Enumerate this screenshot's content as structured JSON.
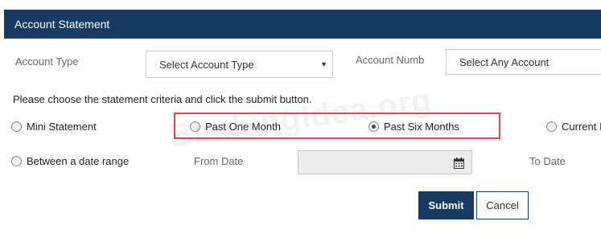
{
  "header": {
    "title": "Account Statement"
  },
  "account_type": {
    "label": "Account Type",
    "selected": "Select Account Type"
  },
  "account_number": {
    "label": "Account Numb",
    "selected": "Select Any Account"
  },
  "instructions": "Please choose the statement criteria and click the submit button.",
  "options": {
    "mini_statement": "Mini Statement",
    "past_one_month": "Past One Month",
    "past_six_months": "Past Six Months",
    "current": "Current I",
    "date_range": "Between a date range"
  },
  "selected_option": "past_six_months",
  "date_range": {
    "from_label": "From Date",
    "to_label": "To Date"
  },
  "buttons": {
    "submit": "Submit",
    "cancel": "Cancel"
  },
  "watermark": "BankingIdea.org",
  "colors": {
    "header_bg": "#173a63",
    "highlight": "#e0474c"
  },
  "icons": {
    "calendar": "calendar-icon",
    "dropdown": "chevron-down-icon"
  }
}
